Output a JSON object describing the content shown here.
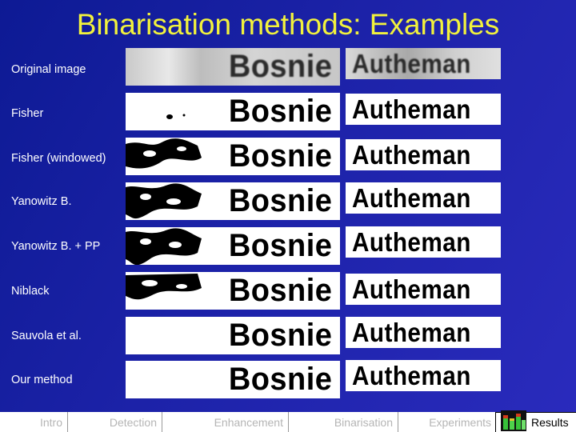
{
  "title": "Binarisation methods: Examples",
  "rows": [
    {
      "label": "Original image",
      "word_left": "Bosnie",
      "word_right": "Autheman",
      "kind": "original"
    },
    {
      "label": "Fisher",
      "word_left": "Bosnie",
      "word_right": "Autheman",
      "kind": "binary"
    },
    {
      "label": "Fisher (windowed)",
      "word_left": "Bosnie",
      "word_right": "Autheman",
      "kind": "binary"
    },
    {
      "label": "Yanowitz B.",
      "word_left": "Bosnie",
      "word_right": "Autheman",
      "kind": "binary"
    },
    {
      "label": "Yanowitz B.  + PP",
      "word_left": "Bosnie",
      "word_right": "Autheman",
      "kind": "binary"
    },
    {
      "label": "Niblack",
      "word_left": "Bosnie",
      "word_right": "Autheman",
      "kind": "binary"
    },
    {
      "label": "Sauvola et al.",
      "word_left": "Bosnie",
      "word_right": "Autheman",
      "kind": "binary"
    },
    {
      "label": "Our method",
      "word_left": "Bosnie",
      "word_right": "Autheman",
      "kind": "binary"
    }
  ],
  "nav": {
    "items": [
      {
        "label": "Intro",
        "active": false
      },
      {
        "label": "Detection",
        "active": false
      },
      {
        "label": "Enhancement",
        "active": false
      },
      {
        "label": "Binarisation",
        "active": false
      },
      {
        "label": "Experiments",
        "active": false
      },
      {
        "label": "Results",
        "active": true,
        "icon": "equalizer-icon"
      }
    ]
  },
  "colors": {
    "title": "#f2f23c",
    "background": "#1c22a8",
    "nav_inactive_text": "#b5b5b5",
    "nav_active_text": "#000000"
  }
}
